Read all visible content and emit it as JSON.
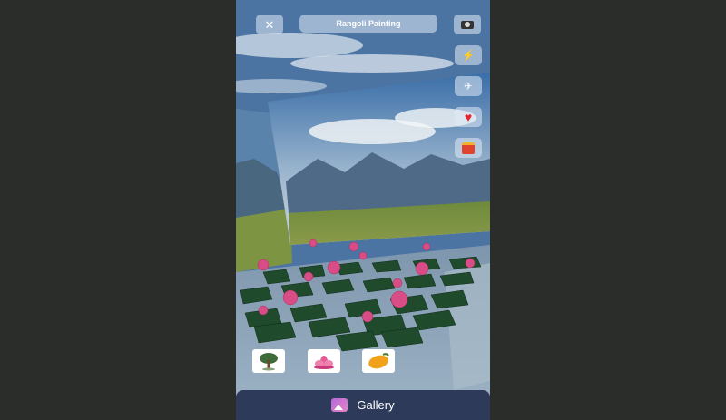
{
  "header": {
    "title": "Rangoli Painting"
  },
  "toolbar": {
    "close_icon": "close-icon",
    "camera_icon": "camera-icon",
    "side_icons": [
      "flash-icon",
      "airplane-icon",
      "heart-icon",
      "gift-icon"
    ]
  },
  "items": [
    {
      "icon": "tree-icon"
    },
    {
      "icon": "lotus-icon"
    },
    {
      "icon": "mango-icon"
    }
  ],
  "footer": {
    "gallery_label": "Gallery",
    "gallery_icon": "gallery-icon"
  },
  "colors": {
    "background": "#2b2d2b",
    "footer_bar": "#2e3a5a",
    "button_fill": "#e1ebf5",
    "heart": "#e0282e"
  }
}
